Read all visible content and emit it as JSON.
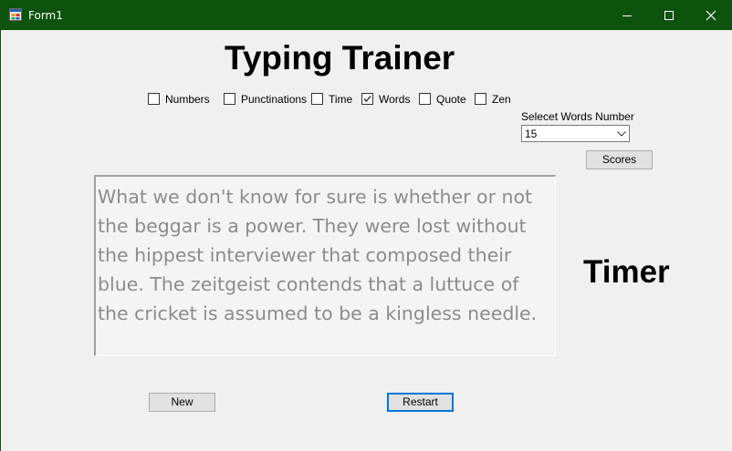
{
  "window": {
    "title": "Form1",
    "icon": "app-form-icon",
    "controls": [
      "minimize-icon",
      "maximize-icon",
      "close-icon"
    ]
  },
  "heading": "Typing Trainer",
  "options": [
    {
      "label": "Numbers",
      "checked": false
    },
    {
      "label": "Punctinations",
      "checked": false
    },
    {
      "label": "Time",
      "checked": false
    },
    {
      "label": "Words",
      "checked": true
    },
    {
      "label": "Quote",
      "checked": false
    },
    {
      "label": "Zen",
      "checked": false
    }
  ],
  "word_count": {
    "label": "Selecet Words Number",
    "value": "15"
  },
  "buttons": {
    "scores": "Scores",
    "new": "New",
    "restart": "Restart"
  },
  "typing_text": "What we don't know for sure is whether or not the beggar is a power. They were lost without the hippest interviewer that composed their blue. The zeitgeist contends that a luttuce of the cricket is assumed to be a kingless needle.",
  "timer": "Timer",
  "colors": {
    "titlebar": "#0d530d",
    "text_gray": "#8c8c8c",
    "focus_border": "#0078d7"
  }
}
